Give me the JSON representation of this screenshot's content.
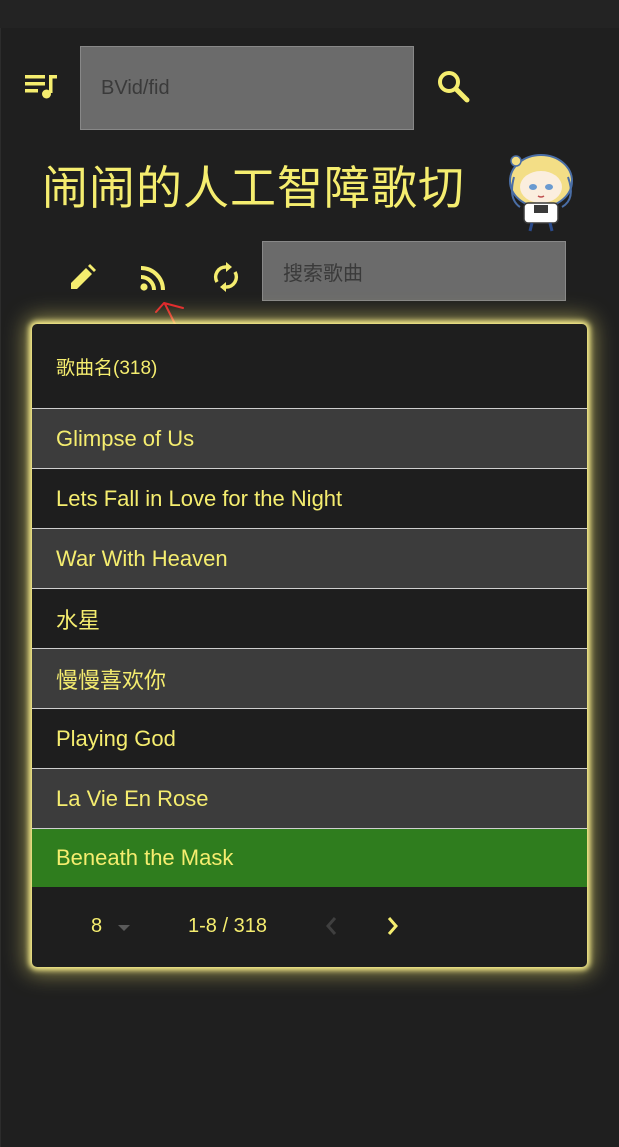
{
  "search_bar": {
    "placeholder": "BVid/fid"
  },
  "header": {
    "title": "闹闹的人工智障歌切"
  },
  "toolbar": {
    "song_search_placeholder": "搜索歌曲"
  },
  "playlist": {
    "header_label": "歌曲名(318)",
    "songs": [
      "Glimpse of Us",
      "Lets Fall in Love for the Night",
      "War With Heaven",
      "水星",
      "慢慢喜欢你",
      "Playing God",
      "La Vie En Rose",
      "Beneath the Mask"
    ],
    "active_index": 7
  },
  "pagination": {
    "rows_per_page": "8",
    "range": "1-8 / 318"
  },
  "colors": {
    "accent": "#f5ed6f",
    "active_row": "#2f7d1e",
    "annotation": "#e0202a"
  },
  "icons": [
    "playlist-icon",
    "search-icon",
    "edit-icon",
    "rss-icon",
    "refresh-icon",
    "chevron-left-icon",
    "chevron-right-icon"
  ]
}
